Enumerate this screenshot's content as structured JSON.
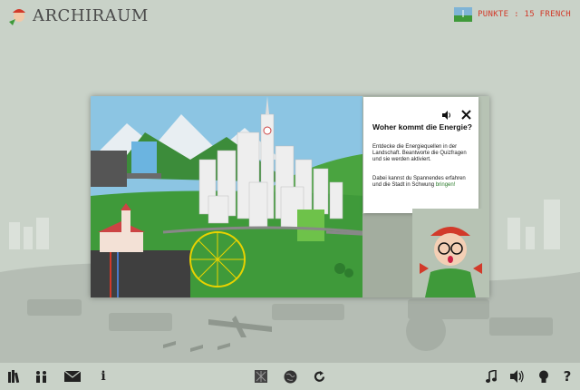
{
  "app": {
    "logo_text": "ARCHIRAUM"
  },
  "header": {
    "points_text": "PUNKTE : 15 FRENCH"
  },
  "info_card": {
    "title": "Woher kommt die Energie?",
    "paragraph1": "Entdecke die Energiequellen in der Landschaft. Beantworte die Quizfragen und sie werden aktiviert.",
    "paragraph2_main": "Dabei kannst du Spannendes erfahren und die Stadt in Schwung ",
    "paragraph2_link": "bringen!"
  },
  "toolbar": {
    "left": [
      "library-icon",
      "people-icon",
      "mail-icon",
      "info-icon"
    ],
    "center": [
      "map-icon",
      "globe-icon",
      "reload-icon"
    ],
    "right": [
      "music-icon",
      "speaker-icon",
      "lightbulb-icon",
      "help-icon"
    ],
    "info_label": "i",
    "help_label": "?"
  },
  "colors": {
    "accent_red": "#d23a2a",
    "background": "#c9d2c8",
    "grass": "#3f9a3a"
  }
}
